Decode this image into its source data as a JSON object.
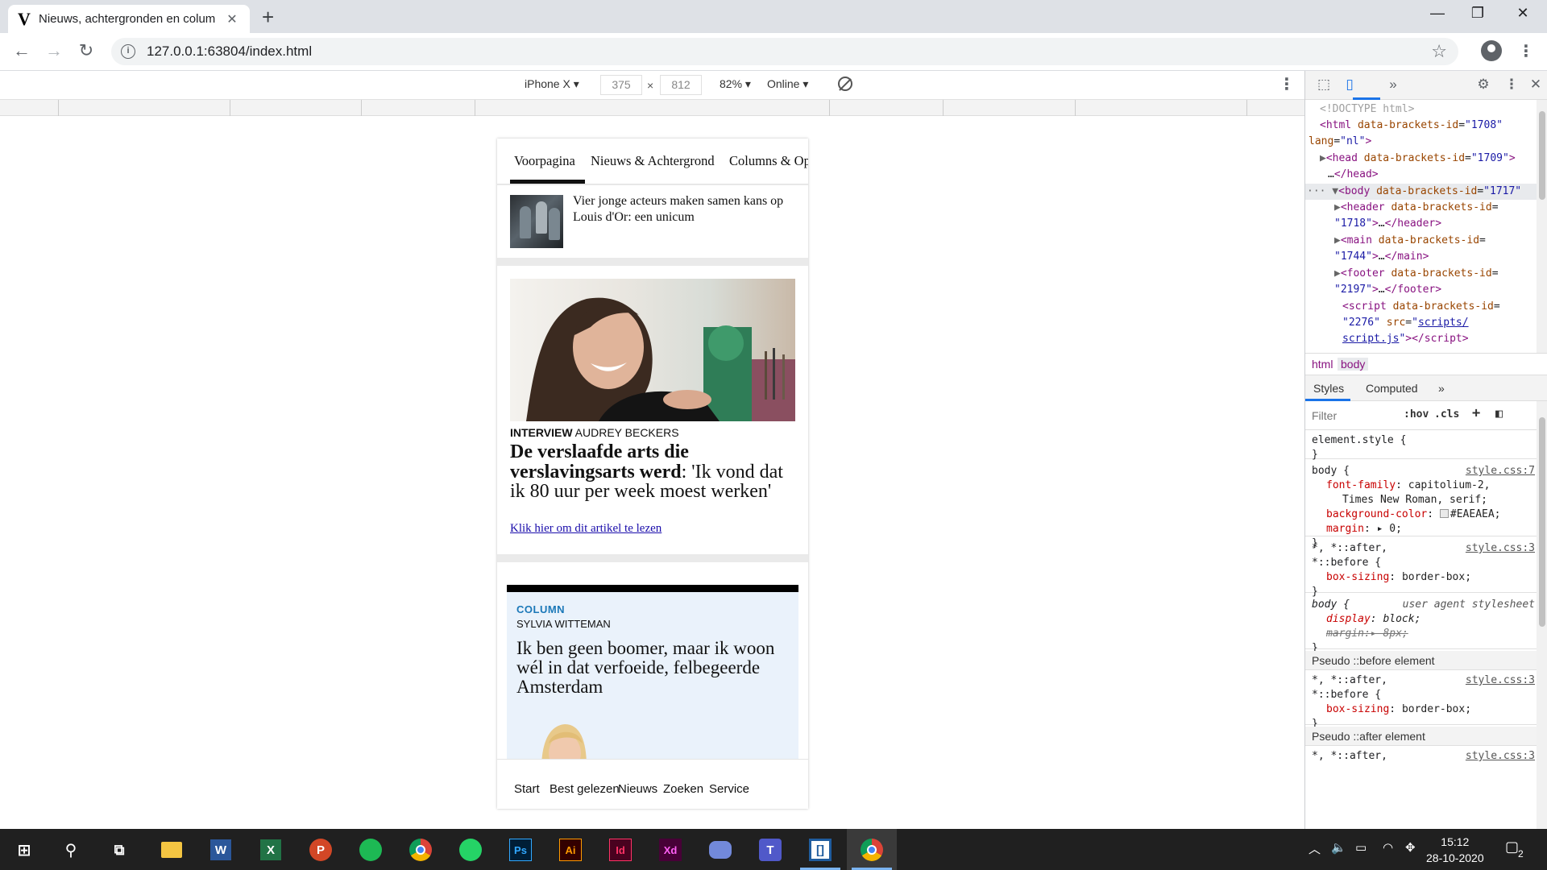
{
  "browser": {
    "tab_title": "Nieuws, achtergronden en colum",
    "tab_favicon": "V",
    "url": "127.0.0.1:63804/index.html"
  },
  "device_toolbar": {
    "device": "iPhone X",
    "width": "375",
    "height": "812",
    "times": "×",
    "zoom": "82%",
    "network": "Online"
  },
  "site": {
    "nav": [
      "Voorpagina",
      "Nieuws & Achtergrond",
      "Columns & Op"
    ],
    "small_article": {
      "headline": "Vier jonge acteurs maken samen kans op Louis d'Or: een unicum"
    },
    "feature": {
      "kicker_label": "INTERVIEW",
      "kicker_author": "AUDREY BECKERS",
      "headline_bold": "De verslaafde arts die verslavingsarts werd",
      "headline_rest": ": 'Ik vond dat ik 80 uur per week moest werken'",
      "link": "Klik hier om dit artikel te lezen"
    },
    "column": {
      "label": "COLUMN",
      "author": "SYLVIA WITTEMAN",
      "headline": "Ik ben geen boomer, maar ik woon wél in dat verfoeide, felbegeerde Amsterdam"
    },
    "bottom_nav": [
      "Start",
      "Best gelezen",
      "Nieuws",
      "Zoeken",
      "Service"
    ]
  },
  "devtools": {
    "elements": {
      "doctype": "<!DOCTYPE html>",
      "html_open": "<html",
      "html_attr": "data-brackets-id",
      "html_attr_val": "\"1708\"",
      "html_lang": "lang",
      "html_lang_val": "\"nl\"",
      "head_id": "\"1709\"",
      "body_id": "\"1717\"",
      "header_id": "1718",
      "main_id": "1744",
      "footer_id": "2197",
      "script_id": "\"2276\"",
      "script_src_a": "scripts/",
      "script_src_b": "script.js"
    },
    "breadcrumbs": [
      "html",
      "body"
    ],
    "tabs": [
      "Styles",
      "Computed"
    ],
    "filter_placeholder": "Filter",
    "hov": ":hov",
    "cls": ".cls",
    "styles": {
      "element_style": "element.style {",
      "body_sel": "body {",
      "src1": "style.css:7",
      "ff_prop": "font-family",
      "ff_val": "capitolium-2,",
      "ff_val2": "Times New Roman, serif;",
      "bg_prop": "background-color",
      "bg_val": "#EAEAEA;",
      "margin_prop": "margin",
      "margin_val": "0;",
      "star_sel": "*, *::after,",
      "star_sel2": "*::before {",
      "src3": "style.css:3",
      "bs_prop": "box-sizing",
      "bs_val": "border-box;",
      "ua_sel": "body {",
      "ua_label": "user agent stylesheet",
      "disp_prop": "display",
      "disp_val": "block;",
      "ua_margin": "margin:",
      "ua_margin_val": "8px;",
      "pseudo_before": "Pseudo ::before element",
      "pseudo_after": "Pseudo ::after element"
    }
  },
  "taskbar": {
    "time": "15:12",
    "date": "28-10-2020",
    "notifications": "2",
    "apps": [
      "File Explorer",
      "Word",
      "Excel",
      "PowerPoint",
      "Spotify",
      "Chrome",
      "WhatsApp",
      "Photoshop",
      "Illustrator",
      "InDesign",
      "XD",
      "Discord",
      "Teams",
      "Brackets",
      "Chrome"
    ]
  }
}
